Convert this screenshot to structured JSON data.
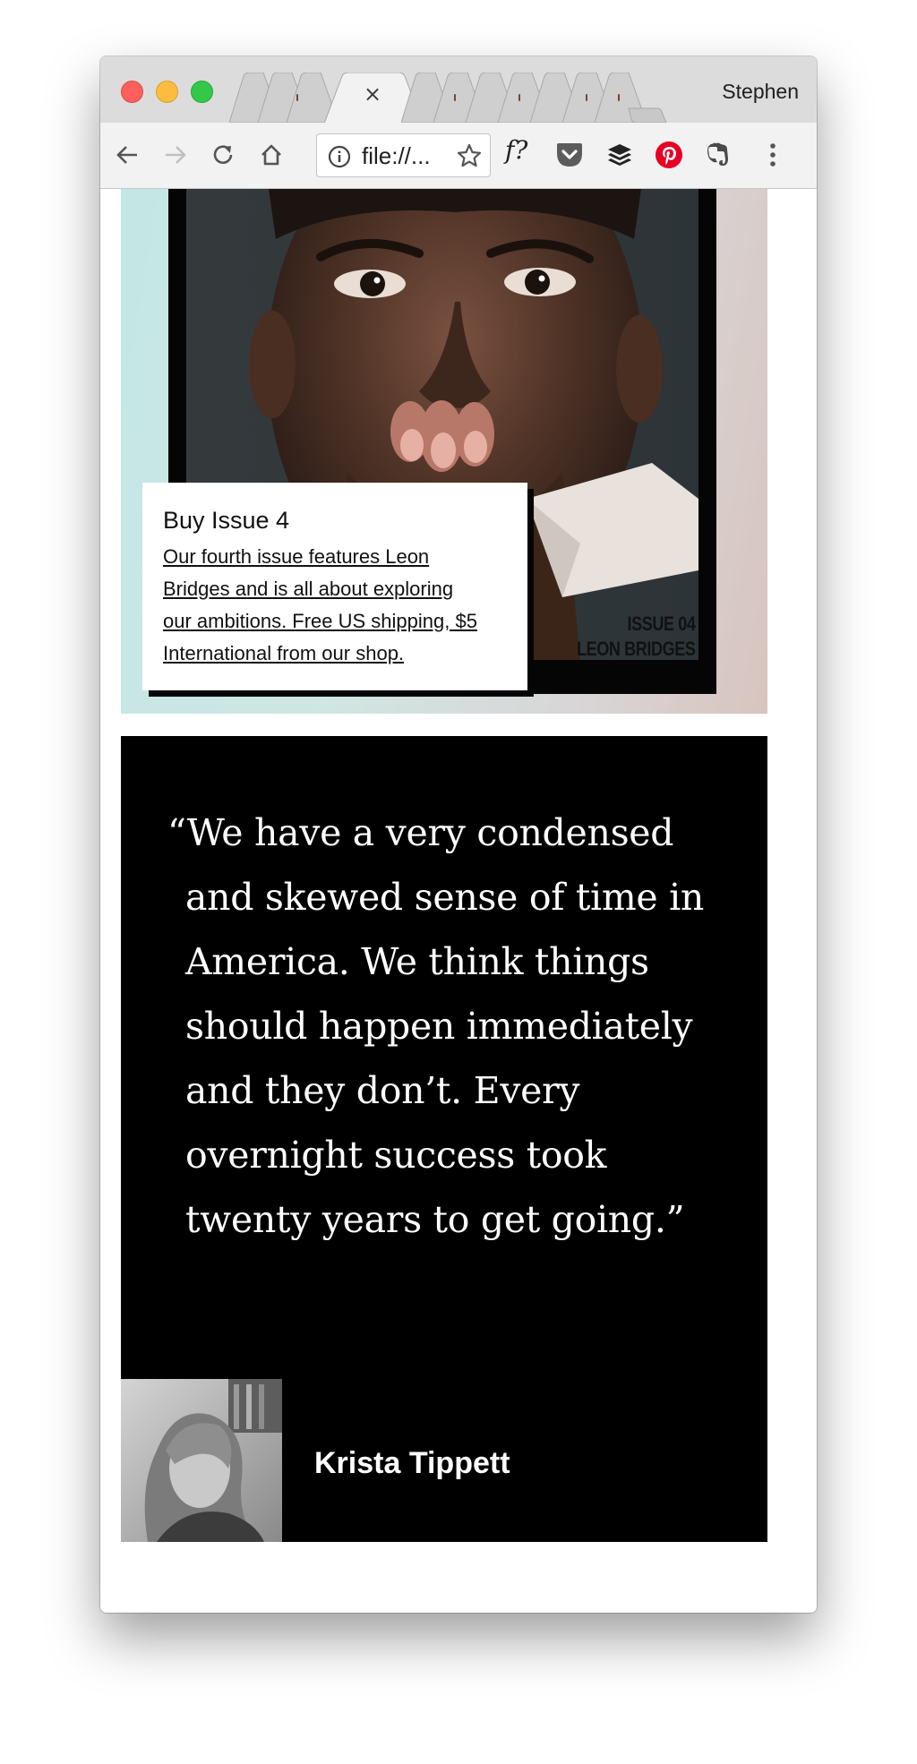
{
  "browser": {
    "profile_name": "Stephen",
    "active_tab_close": "×",
    "address_bar_text": "file://...",
    "extensions": [
      "fontface-ninja-extension",
      "pocket-extension",
      "buffer-extension",
      "pinterest-extension",
      "evernote-extension"
    ],
    "extension_fontface_label": "f?",
    "colors": {
      "close": "#fc605c",
      "minimize": "#fdbc40",
      "zoom": "#34c84a",
      "pinterest": "#e60023"
    }
  },
  "page": {
    "hero": {
      "cover_issue_line1": "ISSUE 04",
      "cover_issue_line2": "LEON BRIDGES",
      "promo_title": "Buy Issue 4",
      "promo_text_line1": "Our fourth issue features Leon",
      "promo_text_line2": "Bridges and is all about exploring",
      "promo_text_line3": "our ambitions. Free US shipping, $5",
      "promo_text_line4": "International from our shop."
    },
    "quote": {
      "text": "“We have a very condensed and skewed sense of time in America. We think things should happen immediately and they don’t. Every overnight success took twenty years to get going.”",
      "author": "Krista Tippett"
    }
  }
}
